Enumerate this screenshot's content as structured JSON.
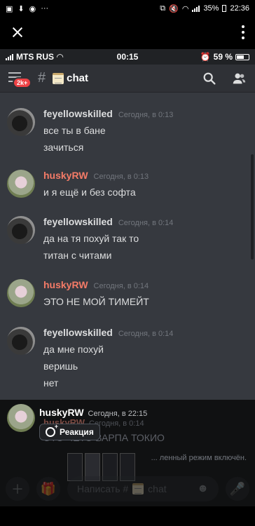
{
  "android_status": {
    "battery": "35%",
    "time": "22:36",
    "more_label": "···"
  },
  "ios_status": {
    "carrier": "MTS RUS",
    "time": "00:15",
    "battery": "59 %"
  },
  "header": {
    "badge": "2k+",
    "hash": "#",
    "channel": "chat"
  },
  "messages": [
    {
      "author": "feyellowskilled",
      "author_color": "#dcddde",
      "timestamp": "Сегодня, в 0:13",
      "lines": [
        "все ты в бане",
        "зачиться"
      ]
    },
    {
      "author": "huskyRW",
      "author_color": "#f47b67",
      "timestamp": "Сегодня, в 0:13",
      "lines": [
        "и я ещё и без софта"
      ]
    },
    {
      "author": "feyellowskilled",
      "author_color": "#dcddde",
      "timestamp": "Сегодня, в 0:14",
      "lines": [
        "да на тя похуй так то",
        "титан с читами"
      ]
    },
    {
      "author": "huskyRW",
      "author_color": "#f47b67",
      "timestamp": "Сегодня, в 0:14",
      "lines": [
        "ЭТО НЕ МОЙ ТИМЕЙТ"
      ]
    },
    {
      "author": "feyellowskilled",
      "author_color": "#dcddde",
      "timestamp": "Сегодня, в 0:14",
      "lines": [
        "да мне похуй",
        "веришь",
        "нет"
      ]
    }
  ],
  "overlay": {
    "peek_author": "huskyRW",
    "peek_timestamp": "Сегодня, в 0:14",
    "peek_text": "ЭТО ЧЕТО ВАРПА ТОКИО",
    "slowmode": "... ленный режим включён.",
    "composer_placeholder": "Написать #",
    "composer_channel": "chat"
  },
  "popup": {
    "author": "huskyRW",
    "timestamp": "Сегодня, в 22:15",
    "reaction_label": "Реакция"
  }
}
